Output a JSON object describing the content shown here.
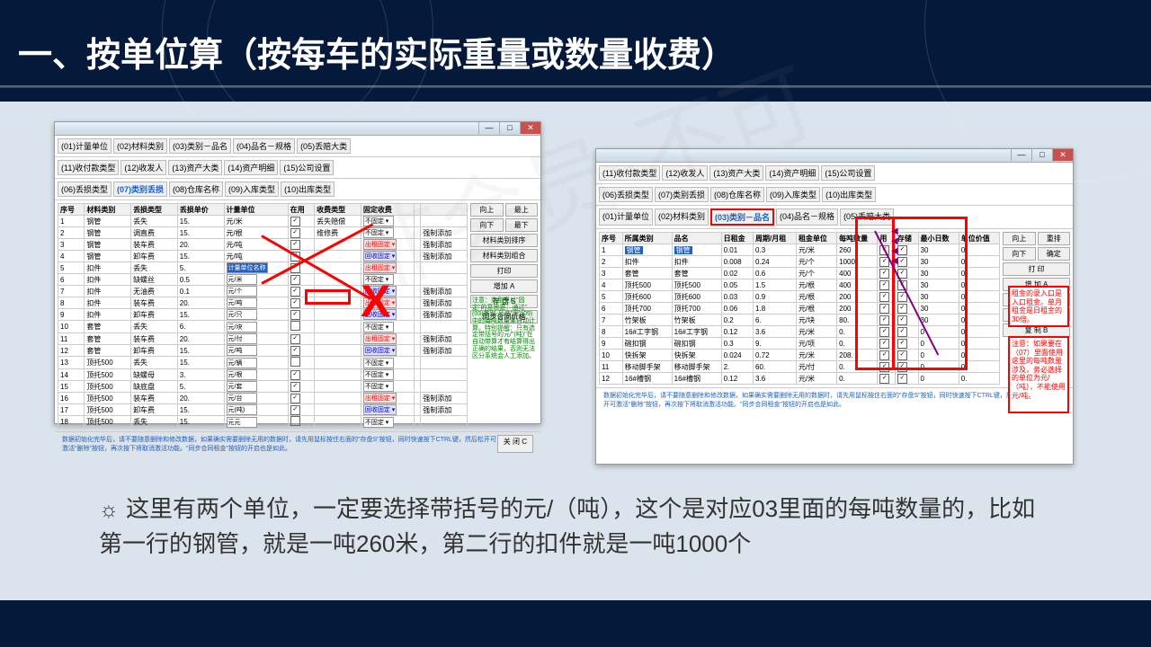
{
  "title": "一、按单位算（按每车的实际重量或数量收费）",
  "watermark": "非会员·不可",
  "win1": {
    "tabs_r1": [
      "(01)计量单位",
      "(02)材料类别",
      "(03)类别－品名",
      "(04)品名－规格",
      "(05)丢赔大类"
    ],
    "tabs_r2": [
      "(11)收付款类型",
      "(12)收发人",
      "(13)资产大类",
      "(14)资产明细",
      "(15)公司设置"
    ],
    "tabs_r3": [
      "(06)丢损类型",
      "(07)类别丢损",
      "(08)仓库名称",
      "(09)入库类型",
      "(10)出库类型"
    ],
    "headers": [
      "序号",
      "材料类别",
      "丢损类型",
      "丢损单价",
      "计量单位",
      "在用",
      "收费类型",
      "固定收费",
      "",
      ""
    ],
    "rows": [
      [
        "1",
        "钢管",
        "丢失",
        "15.",
        "元/米",
        "☑",
        "丢失赔偿",
        "不固定",
        "",
        ""
      ],
      [
        "2",
        "钢管",
        "调直费",
        "15.",
        "元/根",
        "☑",
        "维修费",
        "不固定",
        "",
        "强制添加"
      ],
      [
        "3",
        "钢管",
        "装车费",
        "20.",
        "元/吨",
        "☑",
        "",
        "出租固定",
        "",
        "强制添加"
      ],
      [
        "4",
        "钢管",
        "卸车费",
        "15.",
        "元/吨",
        "☑",
        "",
        "回收固定",
        "",
        "强制添加"
      ],
      [
        "5",
        "扣件",
        "丢失",
        "5.",
        "计量单位名称",
        "☑",
        "",
        "出租固定",
        "",
        ""
      ],
      [
        "6",
        "扣件",
        "缺螺丝",
        "0.5",
        "元/米",
        "☑",
        "",
        "不固定",
        "",
        ""
      ],
      [
        "7",
        "扣件",
        "无油费",
        "0.1",
        "元/个",
        "☑",
        "",
        "回收固定",
        "",
        "强制添加"
      ],
      [
        "8",
        "扣件",
        "装车费",
        "20.",
        "元/吨",
        "☑",
        "",
        "出租固定",
        "",
        "强制添加"
      ],
      [
        "9",
        "扣件",
        "卸车费",
        "15.",
        "元/只",
        "☑",
        "",
        "回收固定",
        "",
        "强制添加"
      ],
      [
        "10",
        "套管",
        "丢失",
        "6.",
        "元/块",
        "",
        "",
        "不固定",
        "",
        ""
      ],
      [
        "11",
        "套管",
        "装车费",
        "20.",
        "元/付",
        "☑",
        "",
        "出租固定",
        "",
        "强制添加"
      ],
      [
        "12",
        "套管",
        "卸车费",
        "15.",
        "元/吨",
        "☑",
        "",
        "回收固定",
        "",
        "强制添加"
      ],
      [
        "13",
        "顶托500",
        "丢失",
        "15.",
        "元/辆",
        "",
        "",
        "不固定",
        "",
        ""
      ],
      [
        "14",
        "顶托500",
        "缺螺母",
        "3.",
        "元/根",
        "☑",
        "",
        "不固定",
        "",
        ""
      ],
      [
        "15",
        "顶托500",
        "缺底盘",
        "5.",
        "元/套",
        "☑",
        "",
        "不固定",
        "",
        ""
      ],
      [
        "16",
        "顶托500",
        "装车费",
        "20.",
        "元/台",
        "☑",
        "",
        "出租固定",
        "",
        "强制添加"
      ],
      [
        "17",
        "顶托500",
        "卸车费",
        "15.",
        "元(吨)",
        "☑",
        "",
        "回收固定",
        "",
        "强制添加"
      ],
      [
        "18",
        "顶托500",
        "丢失",
        "15.",
        "元元",
        "",
        "",
        "不固定",
        "",
        ""
      ]
    ],
    "sidebtns": [
      "向上",
      "最上",
      "向下",
      "最下",
      "材料类别排序",
      "材料类别组合",
      "打印",
      "增加 A",
      "存 盘 S",
      "同步合同价格"
    ],
    "footer_left": "数据初始化完毕后，请不要随意删除和修改数据，如果确实需要删除无用的数据时，请先用鼠标按住右面的\"存盘S\"按钮，同时快速按下CTRL键，然后松开可激活\"删除\"按钮，再次按下将取消激活功能。\"同步合同租金\"按钮的开启也是如此。",
    "close": "关 闭 C",
    "greennote": "注意：类型里以\"固定\"的意思是：通过\"(03)类别-品名\"里\"(09)中的每吨数量乘自动计算。特别提醒：只有选定带括号的元/\"(吨)\"在自动带算才有结算得出正确的结果，否则无法区分系统会人工添加。"
  },
  "win2": {
    "tabs_r1": [
      "(11)收付款类型",
      "(12)收发人",
      "(13)资产大类",
      "(14)资产明细",
      "(15)公司设置"
    ],
    "tabs_r2": [
      "(06)丢损类型",
      "(07)类别丢损",
      "(08)仓库名称",
      "(09)入库类型",
      "(10)出库类型"
    ],
    "tabs_r3": [
      "(01)计量单位",
      "(02)材料类别",
      "(03)类别－品名",
      "(04)品名－规格",
      "(05)丢赔大类"
    ],
    "headers": [
      "序号",
      "所属类别",
      "品名",
      "日租金",
      "周期/月租",
      "租金单位",
      "每吨数量",
      "用",
      "存储",
      "最小日数",
      "单位价值"
    ],
    "rows": [
      [
        "1",
        "钢管",
        "钢管",
        "0.01",
        "0.3",
        "元/米",
        "260",
        "☑",
        "☑",
        "30",
        "0."
      ],
      [
        "2",
        "扣件",
        "扣件",
        "0.008",
        "0.24",
        "元/个",
        "1000",
        "☑",
        "☑",
        "30",
        "0."
      ],
      [
        "3",
        "套管",
        "套管",
        "0.02",
        "0.6",
        "元/个",
        "400",
        "☑",
        "☑",
        "30",
        "0."
      ],
      [
        "4",
        "顶托500",
        "顶托500",
        "0.05",
        "1.5",
        "元/根",
        "400",
        "☑",
        "☑",
        "30",
        "0."
      ],
      [
        "5",
        "顶托600",
        "顶托600",
        "0.03",
        "0.9",
        "元/根",
        "200",
        "☑",
        "☑",
        "30",
        "0."
      ],
      [
        "6",
        "顶托700",
        "顶托700",
        "0.06",
        "1.8",
        "元/根",
        "200",
        "☑",
        "☑",
        "30",
        "0."
      ],
      [
        "7",
        "竹架板",
        "竹架板",
        "0.2",
        "6.",
        "元/块",
        "80.",
        "☑",
        "☑",
        "30",
        "0."
      ],
      [
        "8",
        "16#工字钢",
        "16#工字钢",
        "0.12",
        "3.6",
        "元/米",
        "0.",
        "☑",
        "☑",
        "0",
        "0."
      ],
      [
        "9",
        "碗扣钢",
        "碗扣钢",
        "0.3",
        "9.",
        "元/项",
        "0.",
        "☑",
        "☑",
        "0",
        "0."
      ],
      [
        "10",
        "快拆架",
        "快拆架",
        "0.024",
        "0.72",
        "元/米",
        "208.",
        "☑",
        "☑",
        "0",
        "0."
      ],
      [
        "11",
        "移动脚手架",
        "移动脚手架",
        "2.",
        "60.",
        "元/付",
        "0.",
        "☑",
        "☑",
        "0",
        "0."
      ],
      [
        "12",
        "16#槽钢",
        "16#槽钢",
        "0.12",
        "3.6",
        "元/米",
        "0.",
        "☑",
        "☑",
        "0",
        "0."
      ]
    ],
    "sidebtns": [
      "向上",
      "重排",
      "向下",
      "确定",
      "打 印",
      "增 加 A",
      "存 盘 S",
      "同步合同租金",
      "复 制 B"
    ],
    "callout1": "租金的录入口是入口租金。单月租金是日租金的30倍。",
    "callout2": "注意：如果要在（07）里面使用这里的每吨数量涉及，务必选择的单位为元/（吨），不能使用元/吨。",
    "footer_left": "数据初始化完毕后，请不要随意删除和修改数据，如果确实需要删除无用的数据时，请先用鼠标按住右面的\"存盘S\"按钮，同时快速按下CTRL键，然后松开可激活\"删除\"按钮，再次按下将取消激活功能。\"同步合同租金\"按钮的开启也是如此。",
    "close": "关 闭 C"
  },
  "note": "这里有两个单位，一定要选择带括号的元/（吨），这个是对应03里面的每吨数量的，比如第一行的钢管，就是一吨260米，第二行的扣件就是一吨1000个",
  "sun": "☼"
}
